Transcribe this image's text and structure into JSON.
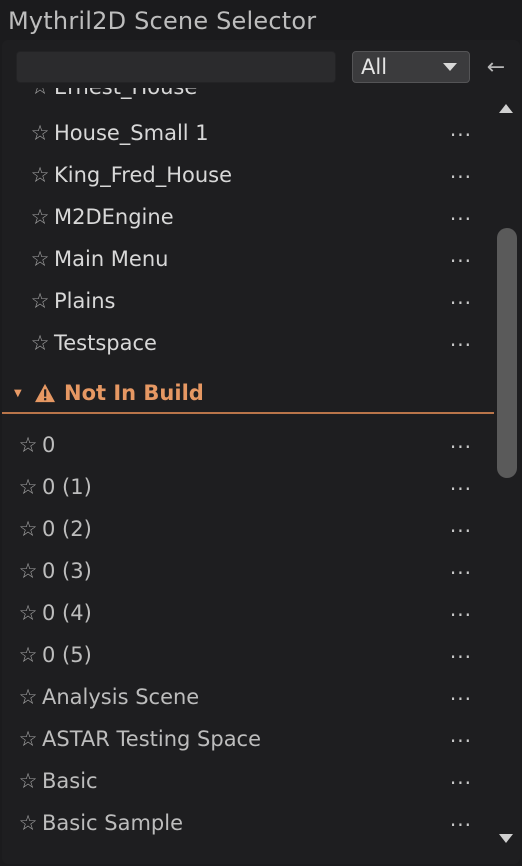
{
  "window": {
    "title": "Mythril2D Scene Selector"
  },
  "toolbar": {
    "search_value": "",
    "filter_value": "All",
    "back_icon": "arrow-left-icon"
  },
  "in_build": [
    {
      "name": "Ernest_House",
      "menu": "···"
    },
    {
      "name": "House_Small 1",
      "menu": "···"
    },
    {
      "name": "King_Fred_House",
      "menu": "···"
    },
    {
      "name": "M2DEngine",
      "menu": "···"
    },
    {
      "name": "Main Menu",
      "menu": "···"
    },
    {
      "name": "Plains",
      "menu": "···"
    },
    {
      "name": "Testspace",
      "menu": "···"
    }
  ],
  "not_in_build": {
    "label": "Not In Build",
    "accent": "#e69863",
    "items": [
      {
        "name": "0",
        "menu": "···"
      },
      {
        "name": "0 (1)",
        "menu": "···"
      },
      {
        "name": "0 (2)",
        "menu": "···"
      },
      {
        "name": "0 (3)",
        "menu": "···"
      },
      {
        "name": "0 (4)",
        "menu": "···"
      },
      {
        "name": "0 (5)",
        "menu": "···"
      },
      {
        "name": "Analysis Scene",
        "menu": "···"
      },
      {
        "name": "ASTAR Testing Space",
        "menu": "···"
      },
      {
        "name": "Basic",
        "menu": "···"
      },
      {
        "name": "Basic Sample",
        "menu": "···"
      }
    ]
  },
  "icons": {
    "favorite": "star-outline-icon",
    "warning": "warning-triangle-icon",
    "row_menu": "ellipsis-icon"
  }
}
